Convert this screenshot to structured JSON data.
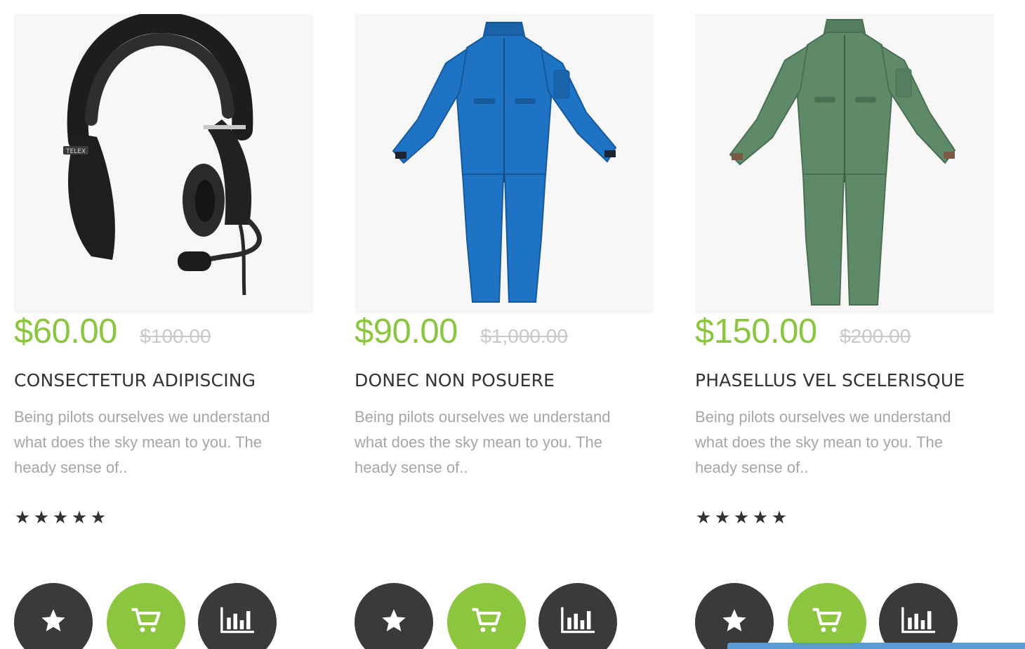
{
  "products": [
    {
      "price": "$60.00",
      "old_price": "$100.00",
      "title": "CONSECTETUR ADIPISCING",
      "description": "Being pilots ourselves we understand what does the sky mean to you. The heady sense of..",
      "image_icon": "headset-image",
      "rating": 5,
      "stars": [
        "★",
        "★",
        "★",
        "★",
        "★"
      ]
    },
    {
      "price": "$90.00",
      "old_price": "$1,000.00",
      "title": "DONEC NON POSUERE",
      "description": "Being pilots ourselves we understand what does the sky mean to you. The heady sense of..",
      "image_icon": "blue-flight-suit-image",
      "rating": 0,
      "stars": []
    },
    {
      "price": "$150.00",
      "old_price": "$200.00",
      "title": "PHASELLUS VEL SCELERISQUE",
      "description": "Being pilots ourselves we understand what does the sky mean to you. The heady sense of..",
      "image_icon": "green-flight-suit-image",
      "rating": 5,
      "stars": [
        "★",
        "★",
        "★",
        "★",
        "★"
      ]
    }
  ],
  "action_icons": {
    "wishlist": "star-icon",
    "cart": "cart-icon",
    "compare": "bar-chart-icon"
  },
  "colors": {
    "accent_green": "#8cc63f",
    "dark_button": "#3a3a3c",
    "old_price_gray": "#c9c9c9",
    "description_gray": "#a6a6a6",
    "title_dark": "#333333",
    "bottom_bar_blue": "#5b9bd5"
  }
}
